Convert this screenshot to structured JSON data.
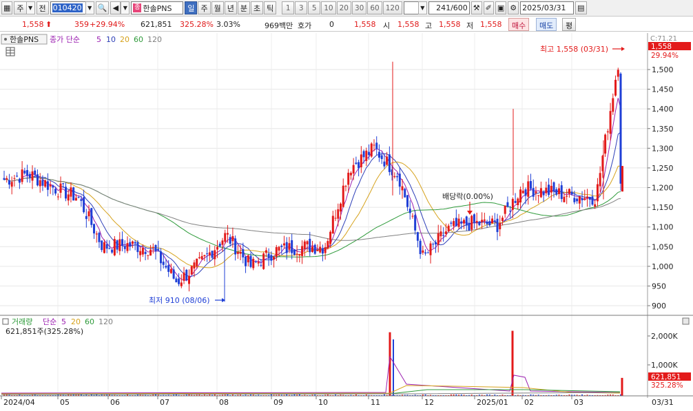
{
  "toolbar": {
    "type_label": "주",
    "prev_label": "전",
    "code": "010420",
    "stock_name": "한솔PNS",
    "stock_badge": "종",
    "periods": [
      "일",
      "주",
      "월",
      "년",
      "분",
      "초",
      "틱"
    ],
    "active_period": "일",
    "minutes": [
      "1",
      "3",
      "5",
      "10",
      "20",
      "30",
      "60",
      "120"
    ],
    "count": "241/600",
    "date": "2025/03/31"
  },
  "quote": {
    "price": "1,558",
    "change": "359",
    "change_pct": "+29.94%",
    "volume": "621,851",
    "volume_ratio": "325.28%",
    "turnover_pct": "3.03%",
    "amount": "969백만",
    "hoga_label": "호가",
    "hoga_value": "0",
    "hoga_price": "1,558",
    "open_label": "시",
    "open": "1,558",
    "high_label": "고",
    "high": "1,558",
    "low_label": "저",
    "low": "1,558",
    "buy_label": "매수",
    "sell_label": "매도",
    "eval_label": "평"
  },
  "price_panel": {
    "name_tag": "한솔PNS",
    "legend_prefix": "종가 단순",
    "ma_periods": [
      "5",
      "10",
      "20",
      "60",
      "120"
    ],
    "top_right_label": "C:71.21",
    "current_price_tag": "1,558",
    "current_pct_tag": "29.94%",
    "high_annotation": "최고 1,558 (03/31)",
    "low_annotation": "최저 910 (08/06)",
    "dividend_annotation": "배당락(0.00%)",
    "y_ticks": [
      "1,500",
      "1,450",
      "1,400",
      "1,350",
      "1,300",
      "1,250",
      "1,200",
      "1,150",
      "1,100",
      "1,050",
      "1,000",
      "950",
      "900"
    ]
  },
  "volume_panel": {
    "legend_title": "거래량",
    "legend_prefix": "단순",
    "ma_periods": [
      "5",
      "20",
      "60",
      "120"
    ],
    "volume_text": "621,851주(325.28%)",
    "y_ticks": [
      "2,000K",
      "1,000K"
    ],
    "current_volume_tag": "621,851",
    "current_ratio_tag": "325.28%"
  },
  "x_axis": {
    "labels": [
      "2024/04",
      "05",
      "06",
      "07",
      "08",
      "09",
      "10",
      "11",
      "12",
      "2025/01",
      "02",
      "03"
    ],
    "end_label": "03/31"
  },
  "colors": {
    "up": "#e31a1a",
    "down": "#1f3fd6",
    "ma5": "#9b1fb0",
    "ma10": "#2d3fb8",
    "ma20": "#d6a21c",
    "ma60": "#2e9a3a",
    "ma120": "#808080"
  },
  "chart_data": {
    "type": "candlestick",
    "title": "한솔PNS",
    "ylim": [
      880,
      1530
    ],
    "x_range": [
      "2024/04",
      "2025/03/31"
    ],
    "highest": {
      "value": 1558,
      "date": "03/31"
    },
    "lowest": {
      "value": 910,
      "date": "08/06"
    },
    "close_path": [
      {
        "date": "2024/04",
        "close": 1220
      },
      {
        "date": "2024/05",
        "close": 1235
      },
      {
        "date": "2024/06",
        "close": 1200
      },
      {
        "date": "2024/06 mid",
        "close": 1175
      },
      {
        "date": "2024/07",
        "close": 1050
      },
      {
        "date": "2024/07 mid",
        "close": 1055
      },
      {
        "date": "2024/08",
        "close": 1045
      },
      {
        "date": "2024/08/06",
        "close": 960
      },
      {
        "date": "2024/08 mid",
        "close": 1010
      },
      {
        "date": "2024/09",
        "close": 1080
      },
      {
        "date": "2024/09 mid",
        "close": 1000
      },
      {
        "date": "2024/10",
        "close": 1040
      },
      {
        "date": "2024/10 mid",
        "close": 1050
      },
      {
        "date": "2024/11",
        "close": 1050
      },
      {
        "date": "2024/11 mid",
        "close": 1250
      },
      {
        "date": "2024/11 end",
        "close": 1300
      },
      {
        "date": "2024/12",
        "close": 1230
      },
      {
        "date": "2024/12 mid",
        "close": 1020
      },
      {
        "date": "2024/12 end",
        "close": 1095
      },
      {
        "date": "2025/01",
        "close": 1110
      },
      {
        "date": "2025/01 mid",
        "close": 1105
      },
      {
        "date": "2025/02",
        "close": 1200
      },
      {
        "date": "2025/02 mid",
        "close": 1190
      },
      {
        "date": "2025/03",
        "close": 1180
      },
      {
        "date": "2025/03 mid",
        "close": 1175
      },
      {
        "date": "2025/03/31",
        "close": 1558
      }
    ],
    "volume_spikes": [
      {
        "date": "2024/11",
        "volume": 2200000
      },
      {
        "date": "2025/01",
        "volume": 2250000
      },
      {
        "date": "2025/03/31",
        "volume": 621851
      }
    ]
  }
}
